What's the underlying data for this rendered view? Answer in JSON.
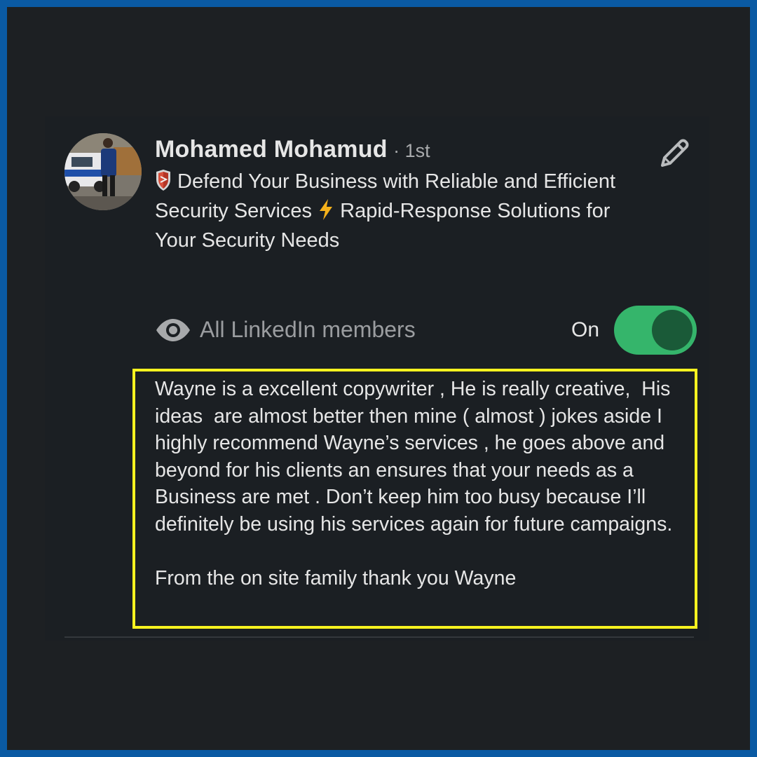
{
  "profile": {
    "name": "Mohamed Mohamud",
    "degree": "· 1st",
    "headline_part1": " Defend Your Business with Reliable and Efficient Security Services ",
    "headline_part2": " Rapid-Response Solutions for Your Security Needs",
    "headline_icons": [
      "shield-emoji-icon",
      "lightning-emoji-icon"
    ]
  },
  "visibility": {
    "label": "All LinkedIn members",
    "icon": "eye-icon"
  },
  "toggle": {
    "label": "On",
    "state": true,
    "color_on": "#35b56b"
  },
  "review": {
    "text": "Wayne is a excellent copywriter , He is really creative,  His ideas  are almost better then mine ( almost ) jokes aside I highly recommend Wayne’s services , he goes above and beyond for his clients an ensures that your needs as a Business are met . Don’t keep him too busy because I’ll definitely be using his services again for future campaigns.",
    "closing": "From the on site family thank you Wayne",
    "highlight_color": "#f7f21f"
  },
  "actions": {
    "edit_icon": "pencil-icon"
  },
  "colors": {
    "border": "#0a5aa3",
    "background": "#1d2023"
  }
}
